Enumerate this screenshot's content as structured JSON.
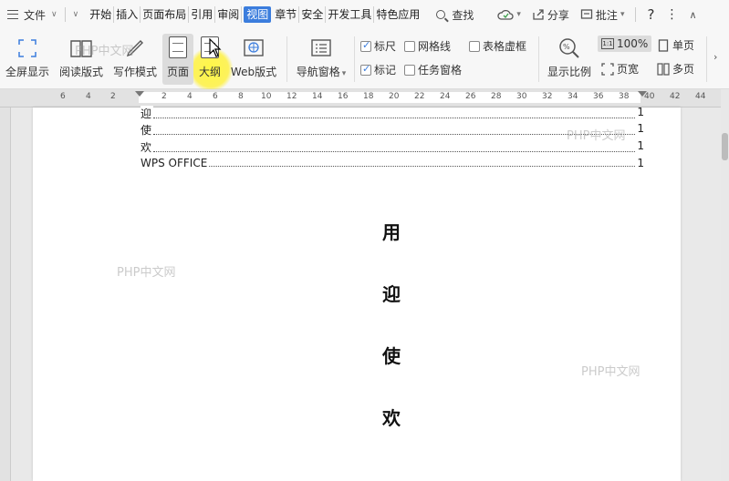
{
  "menubar": {
    "file_label": "文件",
    "tabs": [
      "开始",
      "插入",
      "页面布局",
      "引用",
      "审阅",
      "视图",
      "章节",
      "安全",
      "开发工具",
      "特色应用"
    ],
    "active_tab": "视图",
    "search_label": "查找",
    "share_label": "分享",
    "comment_label": "批注",
    "help_label": "?",
    "more_label": "⋮"
  },
  "ribbon": {
    "fullscreen": "全屏显示",
    "reading": "阅读版式",
    "writing": "写作模式",
    "page": "页面",
    "outline": "大纲",
    "web": "Web版式",
    "nav_pane": "导航窗格",
    "ruler": "标尺",
    "gridlines": "网格线",
    "table_gridlines": "表格虚框",
    "marks": "标记",
    "task_pane": "任务窗格",
    "zoom_ratio": "显示比例",
    "zoom_100": "100%",
    "zoom_box": "1:1",
    "page_width": "页宽",
    "single_page": "单页",
    "multi_page": "多页"
  },
  "ruler": {
    "ticks": [
      "6",
      "4",
      "2",
      "2",
      "4",
      "6",
      "8",
      "10",
      "12",
      "14",
      "16",
      "18",
      "20",
      "22",
      "24",
      "26",
      "28",
      "30",
      "32",
      "34",
      "36",
      "38",
      "40",
      "42",
      "44"
    ]
  },
  "document": {
    "toc": [
      {
        "text": "迎",
        "page": "1"
      },
      {
        "text": "使",
        "page": "1"
      },
      {
        "text": "欢",
        "page": "1"
      },
      {
        "text": "WPS OFFICE",
        "page": "1"
      }
    ],
    "vertical_chars": [
      "用",
      "迎",
      "使",
      "欢"
    ]
  },
  "watermarks": [
    "PHP中文网",
    "PHP中文网",
    "PHP中文网",
    "PHP中文网"
  ]
}
